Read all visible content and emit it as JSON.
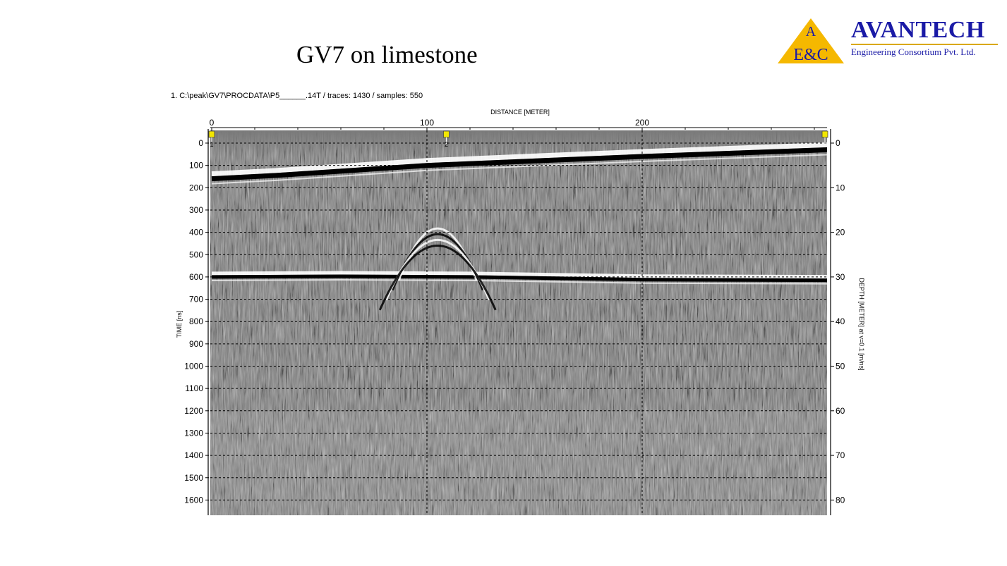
{
  "slide": {
    "title": "GV7 on limestone"
  },
  "logo": {
    "mark_top": "A",
    "mark_bottom": "E&C",
    "name": "AVANTECH",
    "subtitle": "Engineering Consortium Pvt. Ltd.",
    "colors": {
      "triangle": "#f5b800",
      "text": "#1a1aa6"
    }
  },
  "file_info": "1. C:\\peak\\GV7\\PROCDATA\\P5______.14T / traces: 1430 / samples: 550",
  "chart_data": {
    "type": "heatmap",
    "title": "",
    "xlabel": "DISTANCE [METER]",
    "ylabel": "TIME [ns]",
    "y2label": "DEPTH [METER] at v=0.1 [m/ns]",
    "x_ticks": [
      0,
      100,
      200
    ],
    "xlim": [
      0,
      286
    ],
    "y_ticks": [
      0,
      100,
      200,
      300,
      400,
      500,
      600,
      700,
      800,
      900,
      1000,
      1100,
      1200,
      1300,
      1400,
      1500,
      1600
    ],
    "ylim": [
      -50,
      1660
    ],
    "y2_ticks": [
      0,
      10,
      20,
      30,
      40,
      50,
      60,
      70,
      80
    ],
    "grid": true,
    "markers": [
      {
        "x": 0,
        "label": "1"
      },
      {
        "x": 109,
        "label": "2"
      },
      {
        "x": 286,
        "label": ""
      }
    ],
    "reflectors": [
      {
        "name": "surface",
        "x": [
          0,
          30,
          100,
          200,
          286
        ],
        "y": [
          160,
          145,
          100,
          60,
          30
        ]
      },
      {
        "name": "layer-600",
        "x": [
          0,
          60,
          120,
          200,
          286
        ],
        "y": [
          600,
          597,
          600,
          612,
          615
        ]
      },
      {
        "name": "hyperbola",
        "apex_x": 105,
        "apex_y": 315
      }
    ],
    "colors": {
      "background": "#808080",
      "reflector_dark": "#000000",
      "reflector_light": "#ffffff"
    }
  }
}
